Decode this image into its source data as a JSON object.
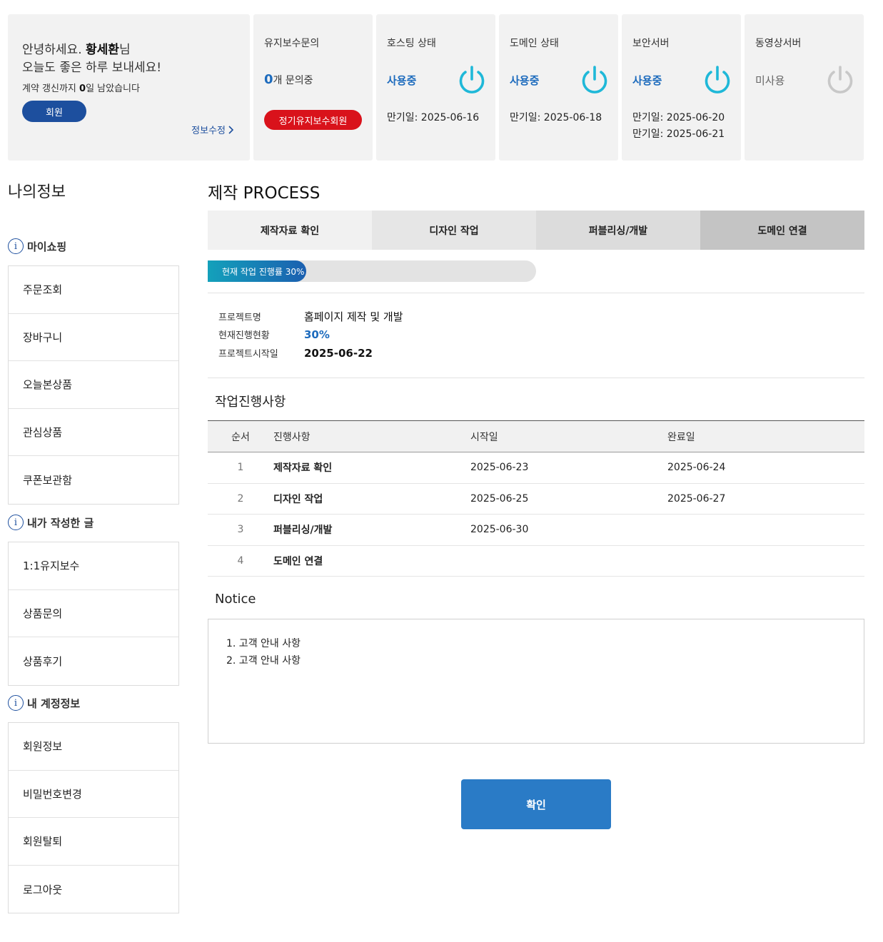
{
  "greeting": {
    "prefix": "안녕하세요. ",
    "name": "황세환",
    "suffix": "님",
    "line2": "오늘도 좋은 하루 보내세요!",
    "renew_prefix": "계약 갱신까지 ",
    "renew_days": "0",
    "renew_suffix": "일 남았습니다",
    "member_label": "회원",
    "edit_label": "정보수정"
  },
  "maintenance": {
    "title": "유지보수문의",
    "count": "0",
    "count_suffix": "개 문의중",
    "badge": "정기유지보수회원"
  },
  "services": [
    {
      "title": "호스팅 상태",
      "status": "사용중",
      "active": true,
      "expiry": [
        "만기일: 2025-06-16"
      ]
    },
    {
      "title": "도메인 상태",
      "status": "사용중",
      "active": true,
      "expiry": [
        "만기일: 2025-06-18"
      ]
    },
    {
      "title": "보안서버",
      "status": "사용중",
      "active": true,
      "expiry": [
        "만기일: 2025-06-20",
        "만기일: 2025-06-21"
      ]
    },
    {
      "title": "동영상서버",
      "status": "미사용",
      "active": false,
      "expiry": []
    }
  ],
  "colors": {
    "power_active": "#1fb8d8",
    "power_inactive": "#c8c8c8",
    "brand": "#1d4f9e",
    "accent": "#1d6bbd",
    "badge_red": "#d9121b"
  },
  "sidebar": {
    "title": "나의정보",
    "sections": [
      {
        "icon": "info-icon",
        "head": "마이쇼핑",
        "items": [
          "주문조회",
          "장바구니",
          "오늘본상품",
          "관심상품",
          "쿠폰보관함"
        ]
      },
      {
        "icon": "info-icon",
        "head": "내가 작성한 글",
        "items": [
          "1:1유지보수",
          "상품문의",
          "상품후기"
        ]
      },
      {
        "icon": "info-icon",
        "head": "내 계정정보",
        "items": [
          "회원정보",
          "비밀번호변경",
          "회원탈퇴",
          "로그아웃"
        ]
      }
    ]
  },
  "process": {
    "title": "제작 PROCESS",
    "tabs": [
      {
        "label": "제작자료 확인",
        "bg": "#f1f1f1"
      },
      {
        "label": "디자인 작업",
        "bg": "#e6e6e6"
      },
      {
        "label": "퍼블리싱/개발",
        "bg": "#dcdcdc"
      },
      {
        "label": "도메인 연결",
        "bg": "#c4c4c4"
      }
    ],
    "progress_label": "현재 작업 진행률 30%",
    "progress_value": 30,
    "info": [
      {
        "key": "프로젝트명",
        "value": "홈페이지 제작 및 개발",
        "style": ""
      },
      {
        "key": "현재진행현황",
        "value": "30%",
        "style": "pct"
      },
      {
        "key": "프로젝트시작일",
        "value": "2025-06-22",
        "style": "b"
      }
    ]
  },
  "tasks": {
    "title": "작업진행사항",
    "headers": [
      "순서",
      "진행사항",
      "시작일",
      "완료일"
    ],
    "rows": [
      [
        "1",
        "제작자료 확인",
        "2025-06-23",
        "2025-06-24"
      ],
      [
        "2",
        "디자인 작업",
        "2025-06-25",
        "2025-06-27"
      ],
      [
        "3",
        "퍼블리싱/개발",
        "2025-06-30",
        ""
      ],
      [
        "4",
        "도메인 연결",
        "",
        ""
      ]
    ]
  },
  "notice": {
    "title": "Notice",
    "lines": [
      "1. 고객 안내 사항",
      "2. 고객 안내 사항"
    ]
  },
  "confirm_label": "확인"
}
